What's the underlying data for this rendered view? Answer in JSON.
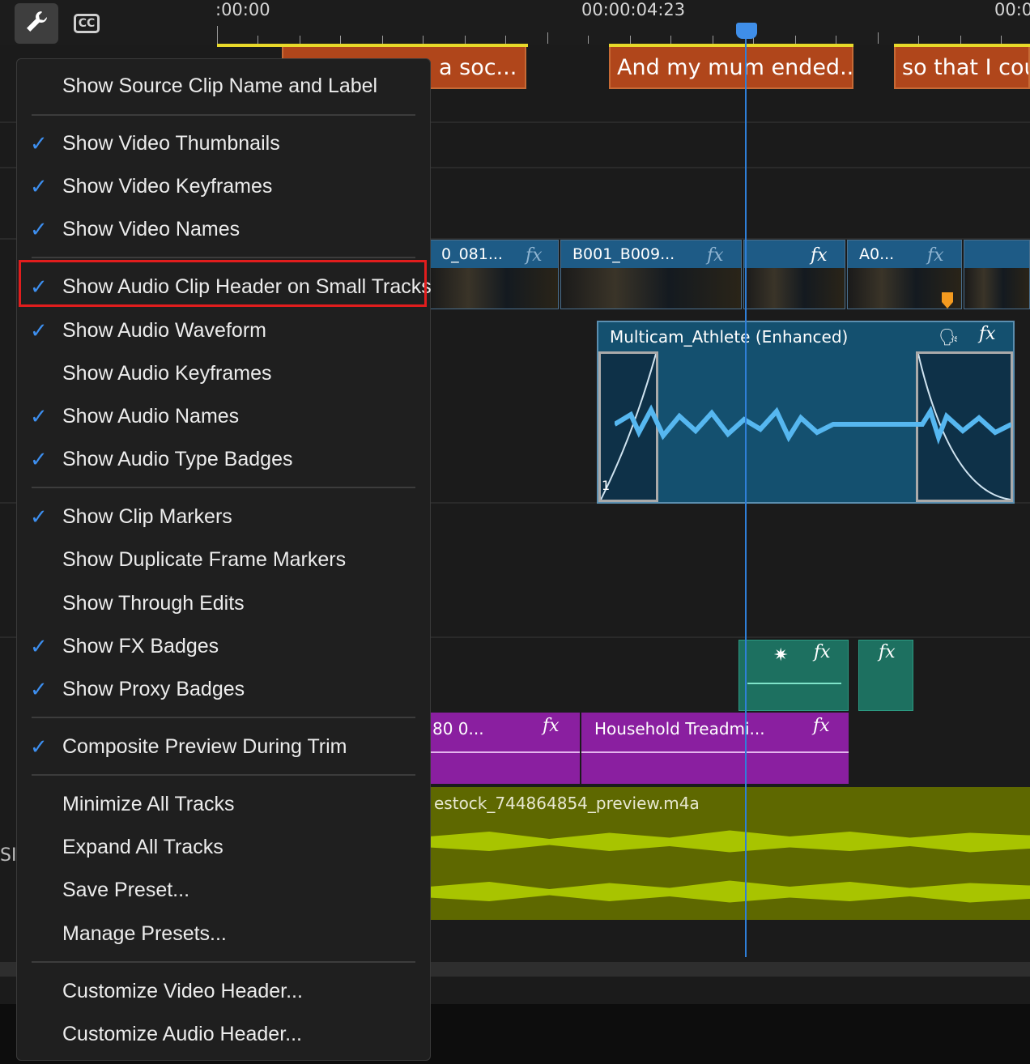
{
  "toolbar": {
    "wrench_icon": "wrench-icon",
    "cc_label": "CC"
  },
  "timeline": {
    "timecodes": [
      ":00:00",
      "00:00:04:23",
      "00:0"
    ],
    "captions": [
      "a soc...",
      "And my mum ended...",
      "so that I coul"
    ],
    "video_clips": [
      "0_081...",
      "B001_B009...",
      "A0..."
    ],
    "audio_clip_name": "Multicam_Athlete (Enhanced)",
    "audio_channel": "1",
    "sfx_clips": [
      "80 0...",
      "Household Treadmi..."
    ],
    "music_clip": "estock_744864854_preview.m4a",
    "left_stub": "SI",
    "colors": {
      "caption": "#b0461b",
      "video_header": "#1e5b86",
      "audio_clip": "#14506f",
      "sfx_clip": "#8a1fa0",
      "music_clip": "#5e6800",
      "playhead": "#2f7fd8",
      "highlight": "#e11d1d"
    }
  },
  "menu": {
    "items": [
      {
        "label": "Show Source Clip Name and Label",
        "checked": ""
      },
      {
        "label": "Show Video Thumbnails",
        "checked": "✓"
      },
      {
        "label": "Show Video Keyframes",
        "checked": "✓"
      },
      {
        "label": "Show Video Names",
        "checked": "✓"
      },
      {
        "label": "Show Audio Clip Header on Small Tracks",
        "checked": "✓"
      },
      {
        "label": "Show Audio Waveform",
        "checked": "✓"
      },
      {
        "label": "Show Audio Keyframes",
        "checked": ""
      },
      {
        "label": "Show Audio Names",
        "checked": "✓"
      },
      {
        "label": "Show Audio Type Badges",
        "checked": "✓"
      },
      {
        "label": "Show Clip Markers",
        "checked": "✓"
      },
      {
        "label": "Show Duplicate Frame Markers",
        "checked": ""
      },
      {
        "label": "Show Through Edits",
        "checked": ""
      },
      {
        "label": "Show FX Badges",
        "checked": "✓"
      },
      {
        "label": "Show Proxy Badges",
        "checked": "✓"
      },
      {
        "label": "Composite Preview During Trim",
        "checked": "✓"
      },
      {
        "label": "Minimize All Tracks",
        "checked": ""
      },
      {
        "label": "Expand All Tracks",
        "checked": ""
      },
      {
        "label": "Save Preset...",
        "checked": ""
      },
      {
        "label": "Manage Presets...",
        "checked": ""
      },
      {
        "label": "Customize Video Header...",
        "checked": ""
      },
      {
        "label": "Customize Audio Header...",
        "checked": ""
      }
    ]
  }
}
